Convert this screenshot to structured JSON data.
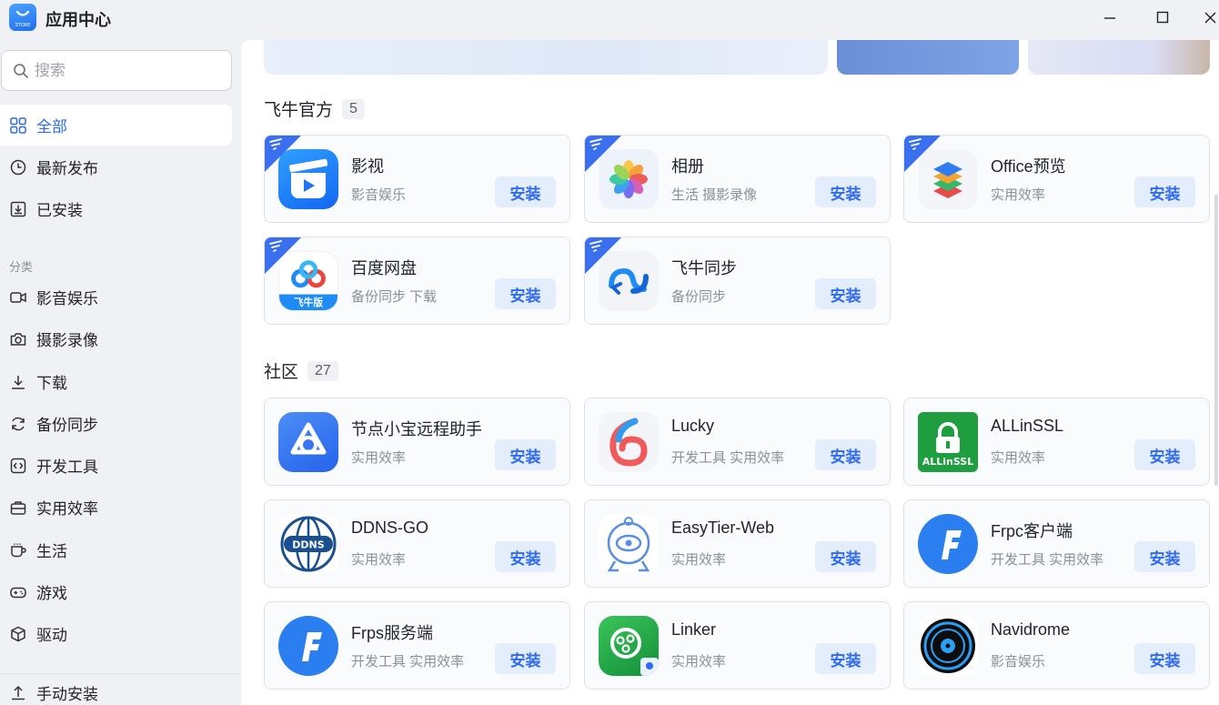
{
  "window": {
    "title": "应用中心",
    "logo_text": "STORE"
  },
  "search": {
    "placeholder": "搜索",
    "value": ""
  },
  "nav": {
    "top": [
      {
        "label": "全部",
        "icon": "grid-icon",
        "active": true
      },
      {
        "label": "最新发布",
        "icon": "clock-icon"
      },
      {
        "label": "已安装",
        "icon": "download-box-icon"
      }
    ],
    "section_label": "分类",
    "categories": [
      {
        "label": "影音娱乐",
        "icon": "video-icon"
      },
      {
        "label": "摄影录像",
        "icon": "camera-icon"
      },
      {
        "label": "下载",
        "icon": "download-icon"
      },
      {
        "label": "备份同步",
        "icon": "sync-icon"
      },
      {
        "label": "开发工具",
        "icon": "code-icon"
      },
      {
        "label": "实用效率",
        "icon": "toolbox-icon"
      },
      {
        "label": "生活",
        "icon": "cup-icon"
      },
      {
        "label": "游戏",
        "icon": "gamepad-icon"
      },
      {
        "label": "驱动",
        "icon": "cube-icon"
      }
    ],
    "bottom": {
      "label": "手动安装",
      "icon": "upload-icon"
    }
  },
  "groups": [
    {
      "title": "飞牛官方",
      "count": "5",
      "apps": [
        {
          "name": "影视",
          "category": "影音娱乐",
          "icon": "film-clapper-icon",
          "official": true
        },
        {
          "name": "相册",
          "category": "生活 摄影录像",
          "icon": "photo-flower-icon",
          "official": true
        },
        {
          "name": "Office预览",
          "category": "实用效率",
          "icon": "office-layers-icon",
          "official": true
        },
        {
          "name": "百度网盘",
          "category": "备份同步 下载",
          "icon": "baidu-cloud-icon",
          "official": true,
          "icon_caption": "飞牛版"
        },
        {
          "name": "飞牛同步",
          "category": "备份同步",
          "icon": "fn-sync-icon",
          "official": true
        }
      ]
    },
    {
      "title": "社区",
      "count": "27",
      "apps": [
        {
          "name": "节点小宝远程助手",
          "category": "实用效率",
          "icon": "node-knot-icon"
        },
        {
          "name": "Lucky",
          "category": "开发工具 实用效率",
          "icon": "lucky-swirl-icon"
        },
        {
          "name": "ALLinSSL",
          "category": "实用效率",
          "icon": "ssl-lock-icon",
          "icon_caption": "ALLinSSL"
        },
        {
          "name": "DDNS-GO",
          "category": "实用效率",
          "icon": "ddns-globe-icon",
          "icon_caption": "DDNS"
        },
        {
          "name": "EasyTier-Web",
          "category": "实用效率",
          "icon": "easytier-robot-icon"
        },
        {
          "name": "Frpc客户端",
          "category": "开发工具 实用效率",
          "icon": "frp-client-icon"
        },
        {
          "name": "Frps服务端",
          "category": "开发工具 实用效率",
          "icon": "frp-server-icon"
        },
        {
          "name": "Linker",
          "category": "实用效率",
          "icon": "linker-icon"
        },
        {
          "name": "Navidrome",
          "category": "影音娱乐",
          "icon": "vinyl-record-icon"
        }
      ]
    }
  ],
  "install_label": "安装",
  "colors": {
    "accent": "#2f6bf0",
    "install_bg": "#e3edfc",
    "official_ribbon": "#3a6ff0"
  }
}
